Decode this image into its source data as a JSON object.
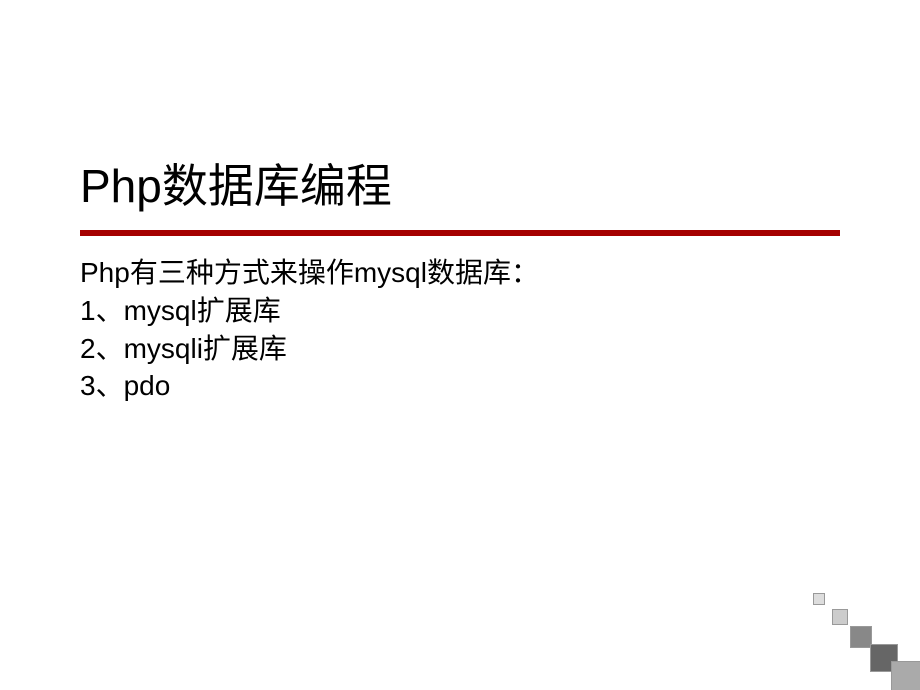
{
  "title": "Php数据库编程",
  "content": {
    "intro": "Php有三种方式来操作mysql数据库：",
    "items": [
      "1、mysql扩展库",
      "2、mysqli扩展库",
      "3、pdo"
    ]
  }
}
